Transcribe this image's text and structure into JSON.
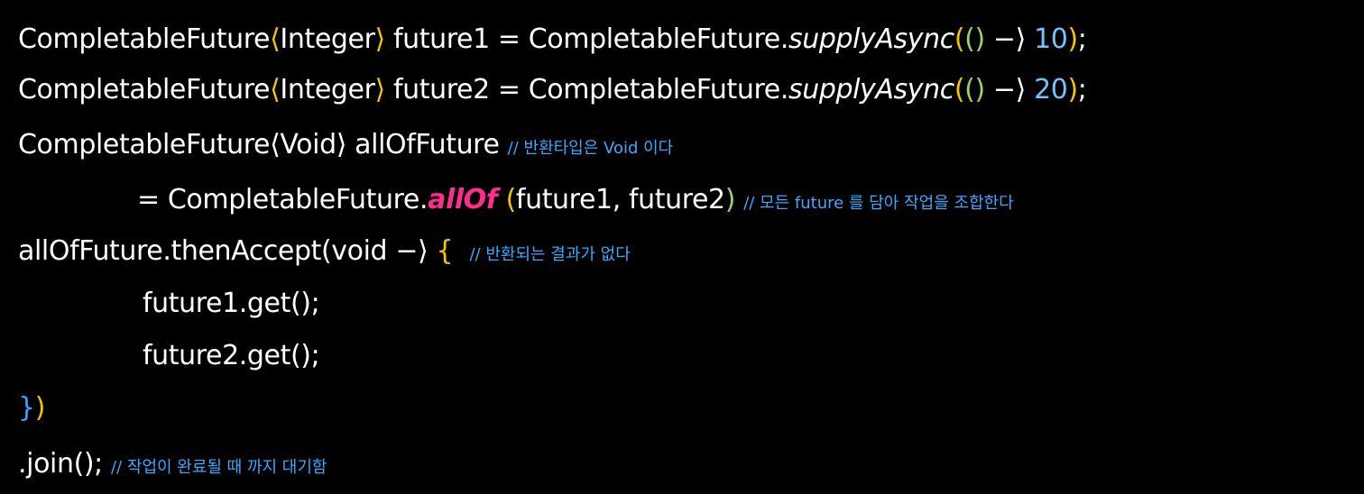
{
  "code": {
    "line1": {
      "type_name": "CompletableFuture",
      "angle_open": "⟨",
      "type_arg": "Integer",
      "angle_close": "⟩",
      "decl": " future1 = CompletableFuture.",
      "method": "supplyAsync",
      "paren_open": "(",
      "lambda": "()",
      "arrow": " −⟩ ",
      "value": "10",
      "paren_close": ")",
      "semicolon": ";"
    },
    "line2": {
      "type_name": "CompletableFuture",
      "angle_open": "⟨",
      "type_arg": "Integer",
      "angle_close": "⟩",
      "decl": " future2 = CompletableFuture.",
      "method": "supplyAsync",
      "paren_open": "(",
      "lambda": "()",
      "arrow": " −⟩ ",
      "value": "20",
      "paren_close": ")",
      "semicolon": ";"
    },
    "line3": {
      "text": "CompletableFuture⟨Void⟩ allOfFuture ",
      "comment": "// 반환타입은 Void 이다"
    },
    "line4": {
      "prefix": "= CompletableFuture.",
      "method": "allOf",
      "space": " ",
      "paren_open": "(",
      "args": "future1, future2",
      "paren_close": ")",
      "gap": " ",
      "comment": "// 모든 future 를 담아 작업을 조합한다"
    },
    "line5": {
      "text": "allOfFuture.thenAccept(void −⟩ ",
      "brace": "{",
      "gap": "  ",
      "comment": "// 반환되는 결과가 없다"
    },
    "line6": {
      "text": "future1.get();"
    },
    "line7": {
      "text": "future2.get();"
    },
    "line8": {
      "brace": "}",
      "paren": ")"
    },
    "line9": {
      "text": ".join();",
      "gap": " ",
      "comment": "// 작업이 완료될 때 까지 대기함"
    }
  },
  "colors": {
    "background": "#000000",
    "text": "#ffffff",
    "comment": "#39a8ff",
    "number": "#6ec4ff",
    "method_highlight": "#ff2d8f",
    "bracket_outer": "#f5c400",
    "bracket_inner": "#9bd36a",
    "brace": "#3ca0ff"
  }
}
